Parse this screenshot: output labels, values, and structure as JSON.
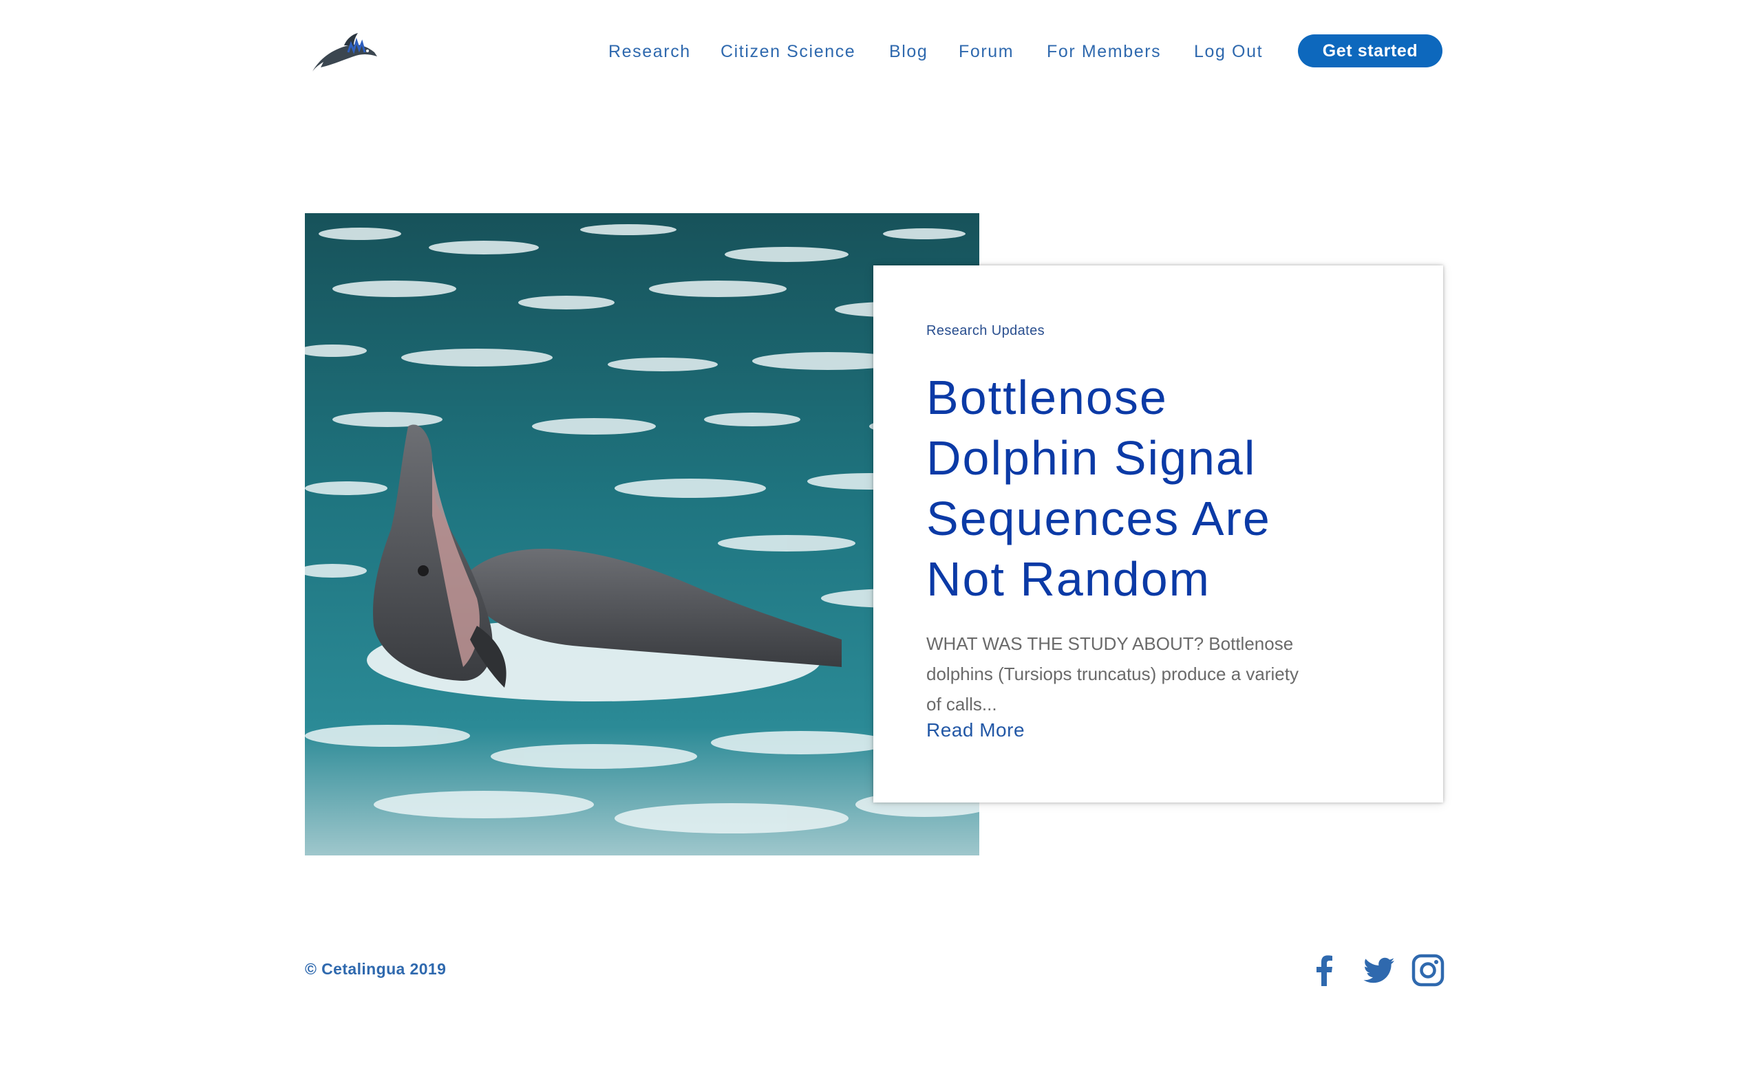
{
  "header": {
    "logo_icon": "dolphin-logo-icon",
    "nav": [
      {
        "label": "Research"
      },
      {
        "label": "Citizen Science"
      },
      {
        "label": "Blog"
      },
      {
        "label": "Forum"
      },
      {
        "label": "For Members"
      },
      {
        "label": "Log Out"
      }
    ],
    "cta_label": "Get started"
  },
  "post": {
    "image_icon": "dolphins-in-water-photo",
    "category": "Research Updates",
    "title_lines": [
      "Bottlenose",
      "Dolphin Signal",
      "Sequences Are",
      "Not Random"
    ],
    "excerpt_lines": [
      "WHAT WAS THE STUDY ABOUT? Bottlenose",
      "dolphins (Tursiops truncatus) produce a variety",
      "of calls..."
    ],
    "read_more": "Read More"
  },
  "footer": {
    "copyright": "© Cetalingua 2019",
    "social": [
      {
        "icon": "facebook-icon"
      },
      {
        "icon": "twitter-icon"
      },
      {
        "icon": "instagram-icon"
      }
    ]
  },
  "colors": {
    "brand_blue": "#0d68bd",
    "nav_text": "#2f69ae",
    "title_text": "#0b3aa6",
    "body_text": "#6a6a6a",
    "water_teal": "#1f6f78"
  }
}
